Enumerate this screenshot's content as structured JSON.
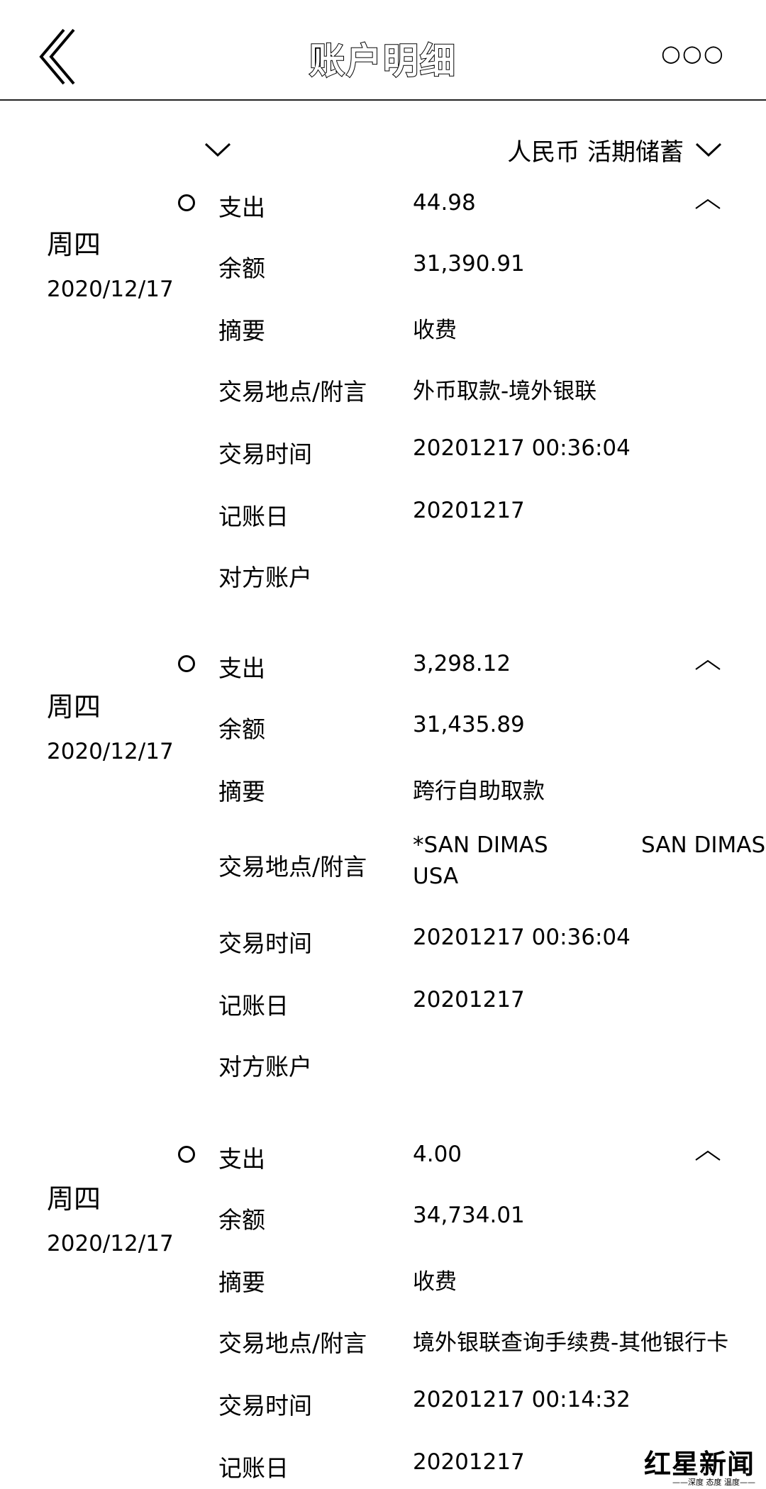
{
  "header": {
    "title": "账户明细",
    "back_icon": "back-chevron-icon",
    "more_icon": "more-dots-icon",
    "more_text": "○○○"
  },
  "filter": {
    "account_value": "",
    "currency_label": "人民币 活期储蓄"
  },
  "transactions": [
    {
      "weekday": "周四",
      "date": "2020/12/17",
      "type_label": "支出",
      "amount": "44.98",
      "balance_label": "余额",
      "balance": "31,390.91",
      "summary_label": "摘要",
      "summary": "收费",
      "location_label": "交易地点/附言",
      "location": "外币取款-境外银联",
      "time_label": "交易时间",
      "time": "20201217 00:36:04",
      "post_label": "记账日",
      "post_date": "20201217",
      "counter_label": "对方账户",
      "counter": ""
    },
    {
      "weekday": "周四",
      "date": "2020/12/17",
      "type_label": "支出",
      "amount": "3,298.12",
      "balance_label": "余额",
      "balance": "31,435.89",
      "summary_label": "摘要",
      "summary": "跨行自助取款",
      "location_label": "交易地点/附言",
      "location": "*SAN DIMAS",
      "location_right": "SAN DIMAS",
      "location_line2": "USA",
      "time_label": "交易时间",
      "time": "20201217 00:36:04",
      "post_label": "记账日",
      "post_date": "20201217",
      "counter_label": "对方账户",
      "counter": ""
    },
    {
      "weekday": "周四",
      "date": "2020/12/17",
      "type_label": "支出",
      "amount": "4.00",
      "balance_label": "余额",
      "balance": "34,734.01",
      "summary_label": "摘要",
      "summary": "收费",
      "location_label": "交易地点/附言",
      "location": "境外银联查询手续费-其他银行卡",
      "time_label": "交易时间",
      "time": "20201217 00:14:32",
      "post_label": "记账日",
      "post_date": "20201217"
    }
  ],
  "watermark": {
    "brand": "红星新闻",
    "tagline": "——深度 态度 温度——"
  }
}
